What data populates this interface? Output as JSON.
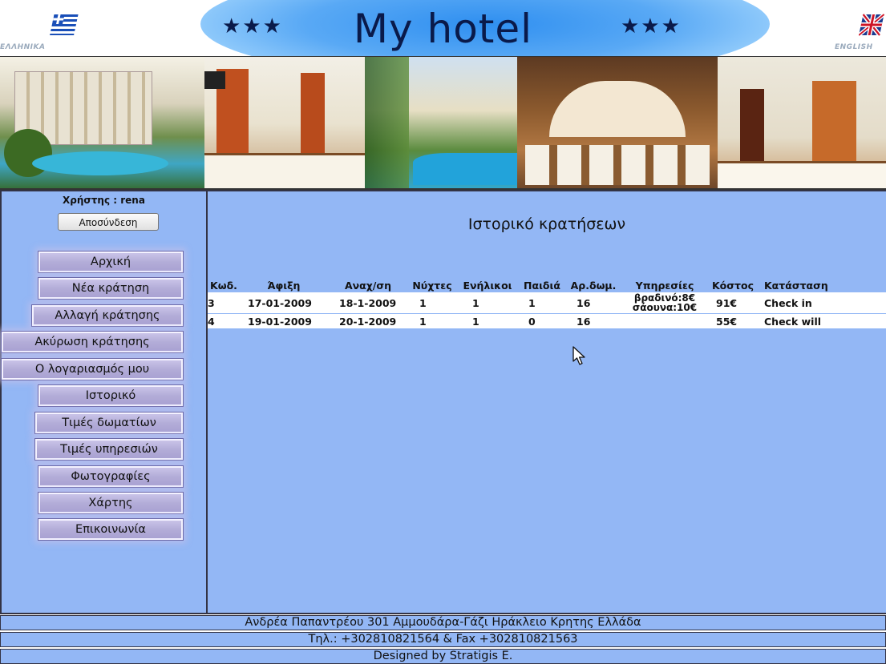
{
  "header": {
    "title": "My hotel",
    "stars_left": "★★★",
    "stars_right": "★★★",
    "lang_greek": "ΕΛΛΗΝΙΚΑ",
    "lang_english": "ENGLISH"
  },
  "sidebar": {
    "user_line": "Χρήστης : rena",
    "logout_label": "Αποσύνδεση",
    "menu": [
      "Αρχική",
      "Νέα κράτηση",
      "Αλλαγή κράτησης",
      "Ακύρωση κράτησης",
      "Ο λογαριασμός μου",
      "Ιστορικό",
      "Τιμές δωματίων",
      "Τιμές υπηρεσιών",
      "Φωτογραφίες",
      "Χάρτης",
      "Επικοινωνία"
    ]
  },
  "main": {
    "title": "Ιστορικό κρατήσεων",
    "columns": [
      "Κωδ.",
      "Άφιξη",
      "Αναχ/ση",
      "Νύχτες",
      "Ενήλικοι",
      "Παιδιά",
      "Αρ.δωμ.",
      "Υπηρεσίες",
      "Κόστος",
      "Κατάσταση"
    ],
    "rows": [
      {
        "code": "3",
        "arrival": "17-01-2009",
        "departure": "18-1-2009",
        "nights": "1",
        "adults": "1",
        "children": "1",
        "room": "16",
        "services_line1": "βραδινό:8€",
        "services_line2": "σάουνα:10€",
        "cost": "91€",
        "status": "Check in"
      },
      {
        "code": "4",
        "arrival": "19-01-2009",
        "departure": "20-1-2009",
        "nights": "1",
        "adults": "1",
        "children": "0",
        "room": "16",
        "services_line1": "",
        "services_line2": "",
        "cost": "55€",
        "status": "Check will"
      }
    ]
  },
  "footer": {
    "address": "Ανδρέα Παπαντρέου 301 Αμμουδάρα-Γάζι Ηράκλειο Κρητης Ελλάδα",
    "phone": "Τηλ.: +302810821564 & Fax +302810821563",
    "designed_by": "Designed by Stratigis E."
  },
  "colors": {
    "panel_background": "#93b7f5",
    "title_navy": "#0a1a4a",
    "menu_button": "#b3add8"
  }
}
